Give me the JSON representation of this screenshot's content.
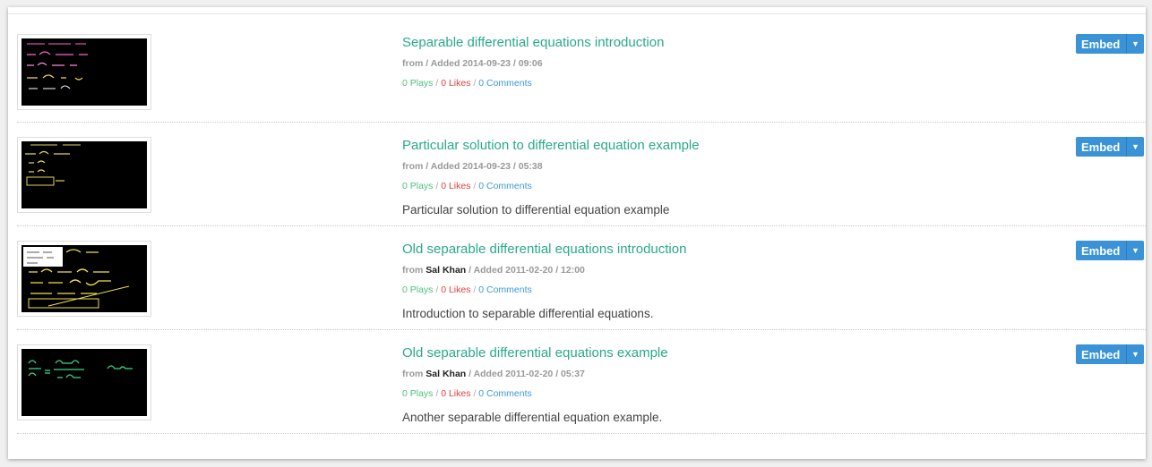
{
  "videos": [
    {
      "title": "Separable differential equations introduction",
      "from_label": "from",
      "author": "",
      "added": " / Added 2014-09-23 / 09:06",
      "plays": "0 Plays",
      "likes": "0 Likes",
      "comments": "0 Comments",
      "description": "",
      "embed_label": "Embed",
      "thumb_color": "#ff66cc"
    },
    {
      "title": "Particular solution to differential equation example",
      "from_label": "from",
      "author": "",
      "added": " / Added 2014-09-23 / 05:38",
      "plays": "0 Plays",
      "likes": "0 Likes",
      "comments": "0 Comments",
      "description": "Particular solution to differential equation example",
      "embed_label": "Embed",
      "thumb_color": "#e3d35a"
    },
    {
      "title": "Old separable differential equations introduction",
      "from_label": "from",
      "author": "Sal Khan",
      "added": " / Added 2011-02-20 / 12:00",
      "plays": "0 Plays",
      "likes": "0 Likes",
      "comments": "0 Comments",
      "description": "Introduction to separable differential equations.",
      "embed_label": "Embed",
      "thumb_color": "#f0e14a"
    },
    {
      "title": "Old separable differential equations example",
      "from_label": "from",
      "author": "Sal Khan",
      "added": " / Added 2011-02-20 / 05:37",
      "plays": "0 Plays",
      "likes": "0 Likes",
      "comments": "0 Comments",
      "description": "Another separable differential equation example.",
      "embed_label": "Embed",
      "thumb_color": "#3ddc84"
    }
  ],
  "icons": {
    "dropdown": "caret-down-icon"
  },
  "colors": {
    "title": "#2aa98a",
    "plays": "#4cc17a",
    "likes": "#e34040",
    "comments": "#3a9ad9",
    "embed": "#3a93d6"
  }
}
